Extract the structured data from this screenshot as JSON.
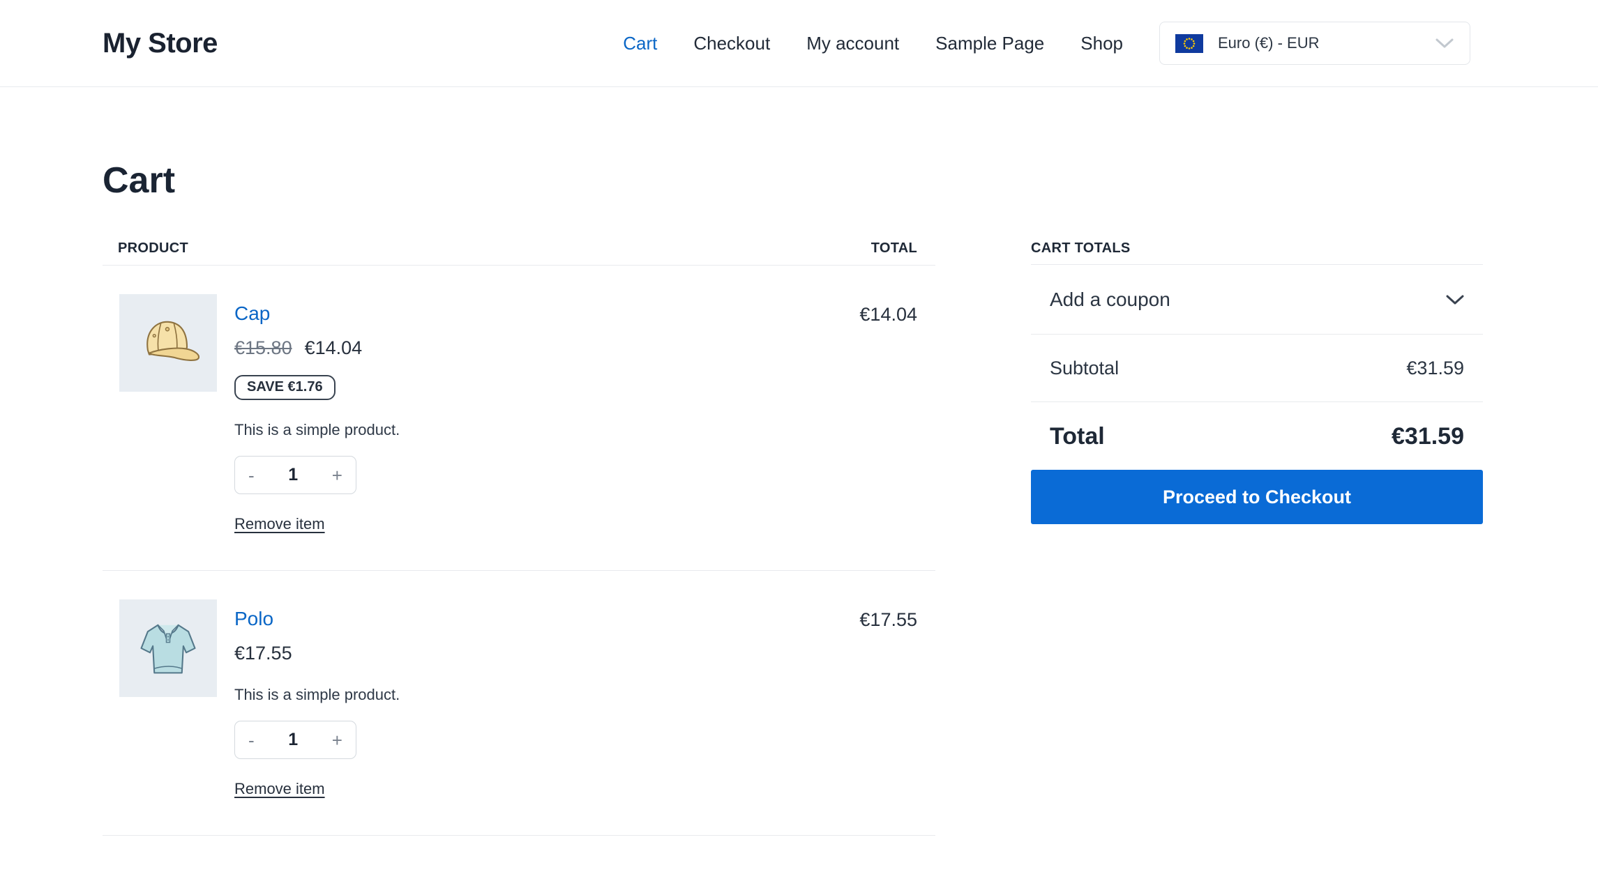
{
  "header": {
    "site_title": "My Store",
    "nav": [
      {
        "label": "Cart",
        "active": true
      },
      {
        "label": "Checkout",
        "active": false
      },
      {
        "label": "My account",
        "active": false
      },
      {
        "label": "Sample Page",
        "active": false
      },
      {
        "label": "Shop",
        "active": false
      }
    ],
    "currency": {
      "label": "Euro (€) - EUR",
      "flag_icon": "eu-flag"
    }
  },
  "page": {
    "title": "Cart"
  },
  "cart": {
    "columns": {
      "product": "PRODUCT",
      "total": "TOTAL"
    },
    "quantity_decrease": "-",
    "quantity_increase": "+",
    "items": [
      {
        "name": "Cap",
        "regular_price": "€15.80",
        "price": "€14.04",
        "save_badge": "SAVE €1.76",
        "description": "This is a simple product.",
        "quantity": "1",
        "remove_label": "Remove item",
        "line_total": "€14.04",
        "image": "cap-illustration"
      },
      {
        "name": "Polo",
        "price": "€17.55",
        "description": "This is a simple product.",
        "quantity": "1",
        "remove_label": "Remove item",
        "line_total": "€17.55",
        "image": "polo-illustration"
      }
    ]
  },
  "totals": {
    "title": "CART TOTALS",
    "coupon_label": "Add a coupon",
    "subtotal_label": "Subtotal",
    "subtotal_value": "€31.59",
    "total_label": "Total",
    "total_value": "€31.59",
    "checkout_button_label": "Proceed to Checkout"
  },
  "colors": {
    "link_blue": "#0a66c6",
    "button_blue": "#0a6bd6",
    "text_dark": "#1e2836",
    "divider": "#e8eaed",
    "thumb_background": "#e8edf2"
  }
}
